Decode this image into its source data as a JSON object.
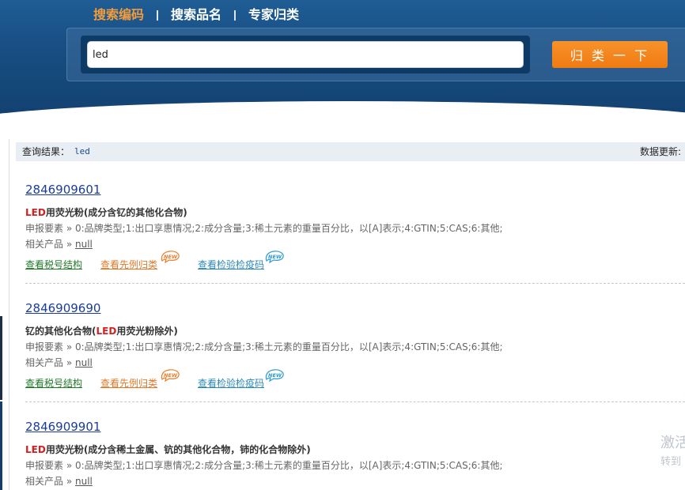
{
  "header": {
    "tabs": [
      {
        "label": "搜索编码",
        "active": true
      },
      {
        "label": "搜索品名",
        "active": false
      },
      {
        "label": "专家归类",
        "active": false
      }
    ],
    "search_value": "led",
    "search_button": "归 类 一 下"
  },
  "query_bar": {
    "label": "查询结果：",
    "term": "led",
    "data_update": "数据更新:"
  },
  "results": [
    {
      "code": "2846909601",
      "name_highlight": "LED",
      "name_rest": "用荧光粉(成分含钇的其他化合物)",
      "name_prefix": "",
      "elements": "申报要素 » 0:品牌类型;1:出口享惠情况;2:成分含量;3:稀土元素的重量百分比，以[A]表示;4:GTIN;5:CAS;6:其他;",
      "related_label": "相关产品 » ",
      "related_value": "null",
      "actions": [
        "查看税号结构",
        "查看先例归类",
        "查看检验检疫码"
      ],
      "badge": "NEW"
    },
    {
      "code": "2846909690",
      "name_prefix": "钇的其他化合物(",
      "name_highlight": "LED",
      "name_rest": "用荧光粉除外)",
      "elements": "申报要素 » 0:品牌类型;1:出口享惠情况;2:成分含量;3:稀土元素的重量百分比，以[A]表示;4:GTIN;5:CAS;6:其他;",
      "related_label": "相关产品 » ",
      "related_value": "null",
      "actions": [
        "查看税号结构",
        "查看先例归类",
        "查看检验检疫码"
      ],
      "badge": "NEW"
    },
    {
      "code": "2846909901",
      "name_prefix": "",
      "name_highlight": "LED",
      "name_rest": "用荧光粉(成分含稀土金属、钪的其他化合物，铈的化合物除外)",
      "elements": "申报要素 » 0:品牌类型;1:出口享惠情况;2:成分含量;3:稀土元素的重量百分比，以[A]表示;4:GTIN;5:CAS;6:其他;",
      "related_label": "相关产品 » ",
      "related_value": "null"
    }
  ],
  "watermark": {
    "line1": "激活",
    "line2": "转到"
  },
  "colors": {
    "header_bg": "#184f84",
    "active_tab": "#f39c3b",
    "button_orange": "#f07a12",
    "highlight_red": "#d42020",
    "link_blue": "#1a3d9b",
    "action_green": "#1f7a28",
    "action_orange": "#e0792a",
    "action_teal": "#2a88b8"
  }
}
